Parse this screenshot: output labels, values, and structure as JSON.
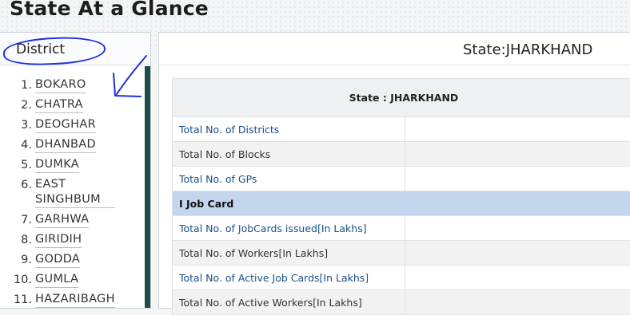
{
  "page": {
    "title": "State At a Glance"
  },
  "district_panel": {
    "title": "District",
    "items": [
      {
        "num": "1.",
        "name": "BOKARO"
      },
      {
        "num": "2.",
        "name": "CHATRA"
      },
      {
        "num": "3.",
        "name": "DEOGHAR"
      },
      {
        "num": "4.",
        "name": "DHANBAD"
      },
      {
        "num": "5.",
        "name": "DUMKA"
      },
      {
        "num": "6.",
        "name": "EAST SINGHBUM"
      },
      {
        "num": "7.",
        "name": "GARHWA"
      },
      {
        "num": "8.",
        "name": "GIRIDIH"
      },
      {
        "num": "9.",
        "name": "GODDA"
      },
      {
        "num": "10.",
        "name": "GUMLA"
      },
      {
        "num": "11.",
        "name": "HAZARIBAGH"
      }
    ]
  },
  "main_panel": {
    "title": "State:JHARKHAND",
    "table_header": "State : JHARKHAND",
    "rows": [
      {
        "label": "Total No. of Districts",
        "value": "",
        "link": true
      },
      {
        "label": "Total No. of Blocks",
        "value": "",
        "link": false
      },
      {
        "label": "Total No. of GPs",
        "value": "",
        "link": true
      },
      {
        "section": "I Job Card"
      },
      {
        "label": "Total No. of JobCards issued[In Lakhs]",
        "value": "",
        "link": true
      },
      {
        "label": "Total No. of Workers[In Lakhs]",
        "value": "",
        "link": false
      },
      {
        "label": "Total No. of Active Job Cards[In Lakhs]",
        "value": "",
        "link": true
      },
      {
        "label": "Total No. of Active Workers[In Lakhs]",
        "value": "",
        "link": false
      }
    ]
  },
  "annotation": {
    "color": "#1d2fe0"
  }
}
